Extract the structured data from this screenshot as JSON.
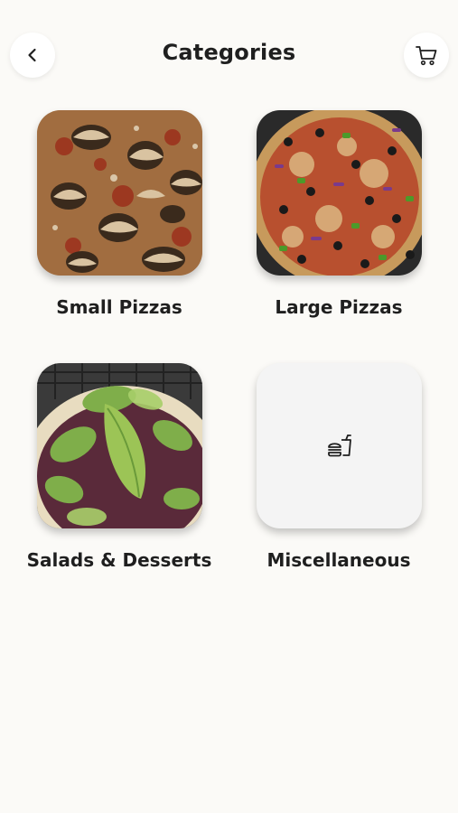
{
  "header": {
    "title": "Categories",
    "back_icon": "chevron-left-icon",
    "cart_icon": "shopping-cart-icon"
  },
  "categories": [
    {
      "label": "Small Pizzas",
      "image": "mushroom-pizza-photo"
    },
    {
      "label": "Large Pizzas",
      "image": "supreme-pizza-photo"
    },
    {
      "label": "Salads & Desserts",
      "image": "green-salad-photo"
    },
    {
      "label": "Miscellaneous",
      "image": "fastfood-icon"
    }
  ],
  "colors": {
    "background": "#fbfaf7",
    "text": "#1f1f1f",
    "placeholder_tile": "#f4f4f4"
  }
}
